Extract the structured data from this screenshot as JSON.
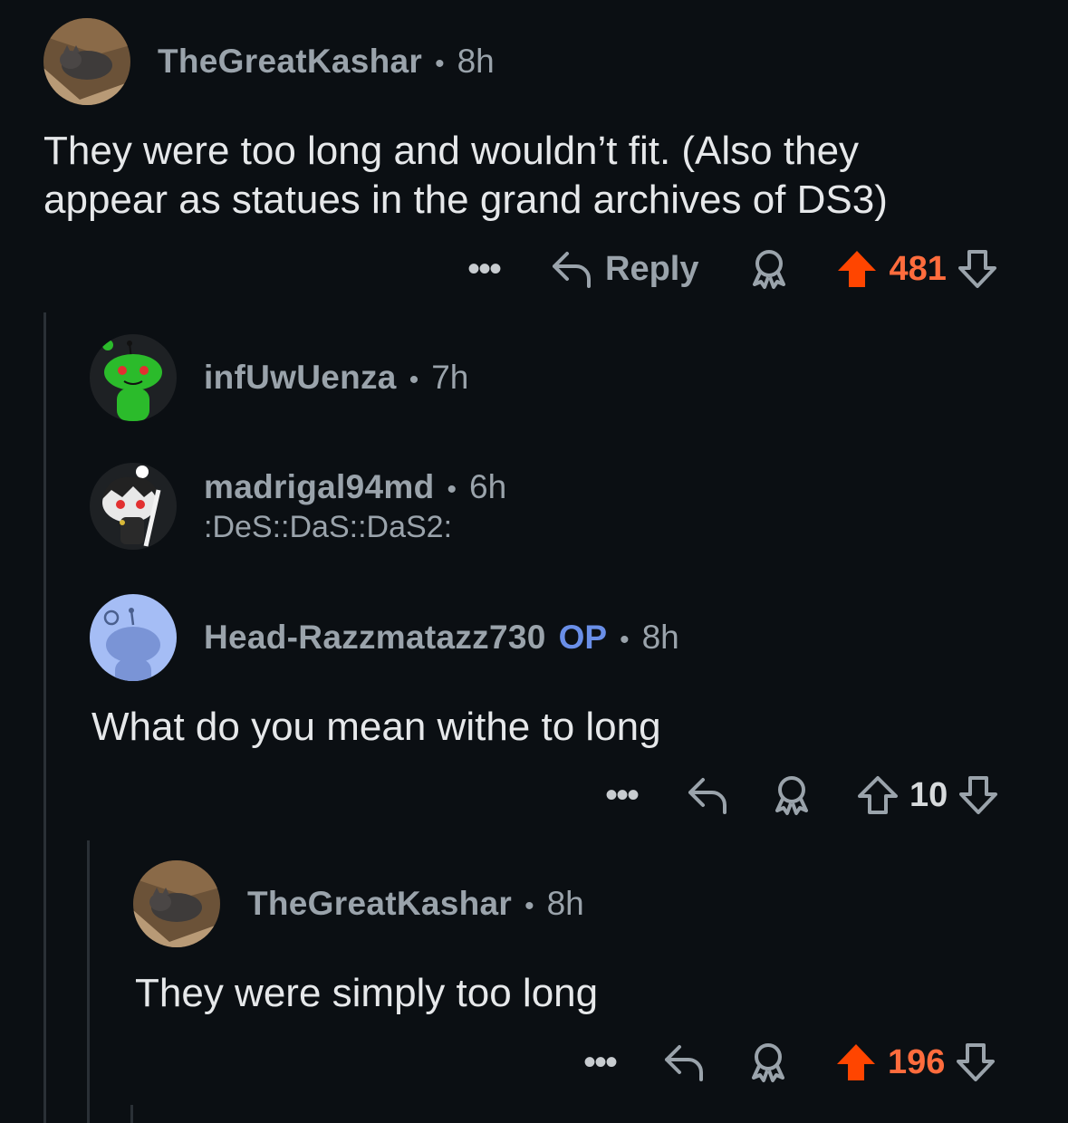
{
  "comments": [
    {
      "username": "TheGreatKashar",
      "time": "8h",
      "body_line1": "They were too long and wouldn’t fit. (Also they",
      "body_line2": "appear as statues in the grand archives of DS3)",
      "more_label": "•••",
      "reply_label": "Reply",
      "score": "481",
      "vote_state": "upvoted",
      "avatar_icon": "cat-in-box-avatar"
    },
    {
      "username": "infUwUenza",
      "time": "7h",
      "avatar_icon": "green-snoo-avatar"
    },
    {
      "username": "madrigal94md",
      "time": "6h",
      "flair": ":DeS::DaS::DaS2:",
      "avatar_icon": "anime-snoo-avatar"
    },
    {
      "username": "Head-Razzmatazz730",
      "op_label": "OP",
      "time": "8h",
      "body": "What do you mean withe to long",
      "more_label": "•••",
      "score": "10",
      "vote_state": "none",
      "avatar_icon": "default-blue-snoo-avatar"
    },
    {
      "username": "TheGreatKashar",
      "time": "8h",
      "body": "They were simply too long",
      "more_label": "•••",
      "score": "196",
      "vote_state": "upvoted",
      "avatar_icon": "cat-in-box-avatar"
    }
  ],
  "separator": "•",
  "colors": {
    "background": "#0b0f13",
    "upvote": "#ff4500",
    "score_up": "#ff6c3d",
    "op": "#6a8fe8",
    "meta": "#9aa3ab"
  }
}
